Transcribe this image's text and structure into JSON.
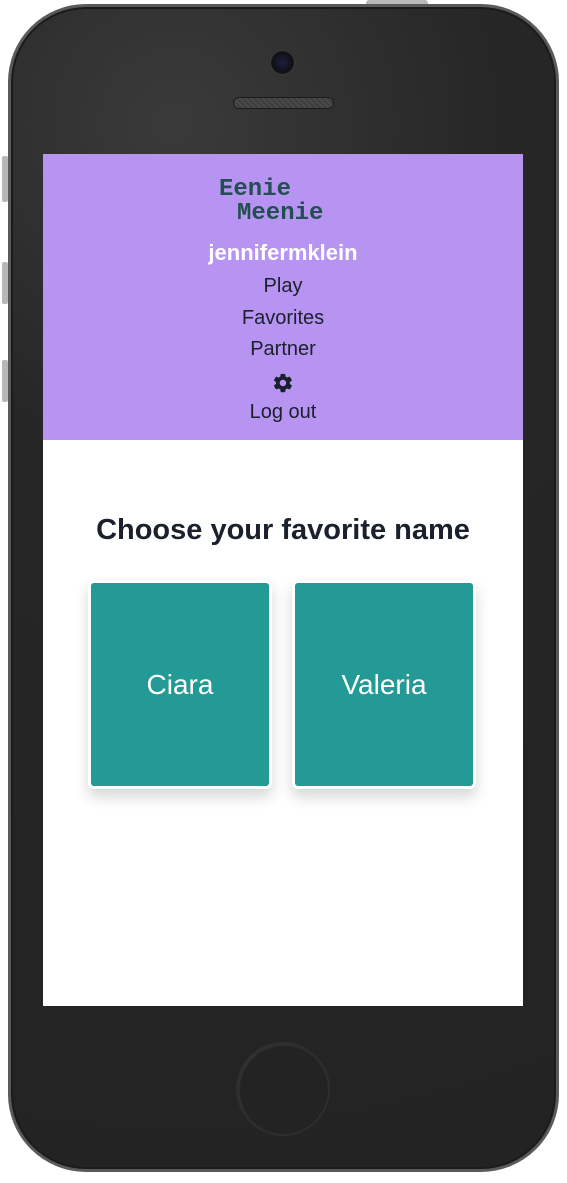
{
  "app": {
    "logo_line1": "Eenie",
    "logo_line2": "Meenie",
    "username": "jennifermklein"
  },
  "nav": {
    "play": "Play",
    "favorites": "Favorites",
    "partner": "Partner",
    "settings_icon": "gear-icon",
    "logout": "Log out"
  },
  "main": {
    "heading": "Choose your favorite name",
    "choices": [
      {
        "label": "Ciara"
      },
      {
        "label": "Valeria"
      }
    ]
  },
  "colors": {
    "header_bg": "#b794f2",
    "logo": "#234e52",
    "card_bg": "#239a95",
    "text_dark": "#1a202c"
  }
}
